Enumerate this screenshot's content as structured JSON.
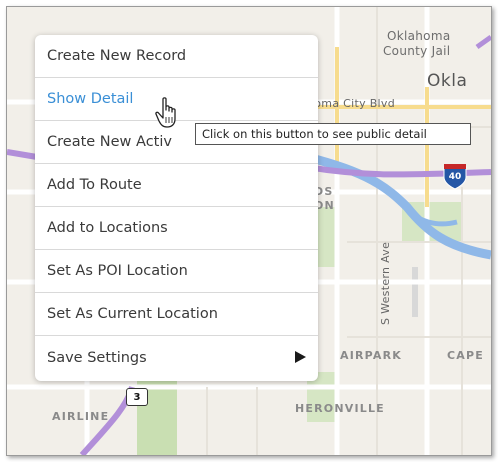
{
  "map": {
    "labels": {
      "county_jail_line1": "Oklahoma",
      "county_jail_line2": "County Jail",
      "okla": "Okla",
      "oklahoma_city_blvd": "homa City Blvd",
      "airpark": "AIRPARK",
      "cape": "CAPE",
      "airline": "AIRLINE",
      "heronville": "HERONVILLE",
      "s_western_ave": "S Western Ave",
      "ds": "DS",
      "on": "ON"
    },
    "shields": {
      "state_route": "3",
      "interstate": "40"
    },
    "colors": {
      "land": "#f2efe9",
      "water": "#8fb8e8",
      "park": "#c9dfb2",
      "highway": "#b28fd9",
      "road": "#ffffff"
    }
  },
  "context_menu": {
    "items": [
      {
        "label": "Create New Record"
      },
      {
        "label": "Show Detail"
      },
      {
        "label": "Create New Activ"
      },
      {
        "label": "Add To Route"
      },
      {
        "label": "Add to Locations"
      },
      {
        "label": "Set As POI Location"
      },
      {
        "label": "Set As Current Location"
      },
      {
        "label": "Save Settings"
      }
    ],
    "active_index": 1,
    "active_color": "#3a8fd6"
  },
  "tooltip": {
    "text": "Click on this button to see public detail"
  },
  "annotation": {
    "arrow_color": "#e53935"
  }
}
